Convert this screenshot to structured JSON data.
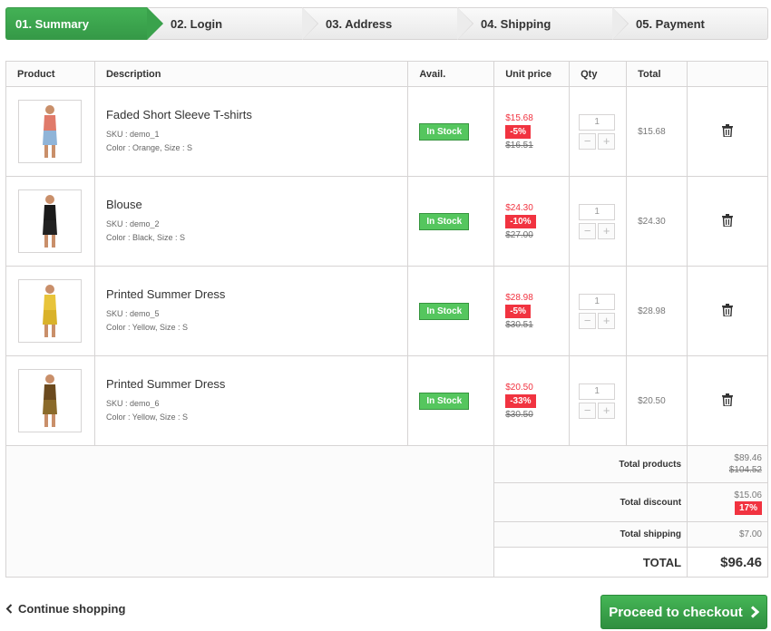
{
  "steps": [
    "01. Summary",
    "02. Login",
    "03. Address",
    "04. Shipping",
    "05. Payment"
  ],
  "table": {
    "headers": {
      "product": "Product",
      "description": "Description",
      "avail": "Avail.",
      "unit_price": "Unit price",
      "qty": "Qty",
      "total": "Total"
    },
    "items": [
      {
        "name": "Faded Short Sleeve T-shirts",
        "sku": "SKU : demo_1",
        "attrs": "Color : Orange, Size : S",
        "avail": "In Stock",
        "price": "$15.68",
        "discount": "-5%",
        "old_price": "$16.51",
        "qty": "1",
        "total": "$15.68",
        "colors": {
          "top": "#e07a6a",
          "bottom": "#8fb4d8"
        }
      },
      {
        "name": "Blouse",
        "sku": "SKU : demo_2",
        "attrs": "Color : Black, Size : S",
        "avail": "In Stock",
        "price": "$24.30",
        "discount": "-10%",
        "old_price": "$27.00",
        "qty": "1",
        "total": "$24.30",
        "colors": {
          "top": "#1a1a1a",
          "bottom": "#222222"
        }
      },
      {
        "name": "Printed Summer Dress",
        "sku": "SKU : demo_5",
        "attrs": "Color : Yellow, Size : S",
        "avail": "In Stock",
        "price": "$28.98",
        "discount": "-5%",
        "old_price": "$30.51",
        "qty": "1",
        "total": "$28.98",
        "colors": {
          "top": "#e8c43a",
          "bottom": "#d9b22a"
        }
      },
      {
        "name": "Printed Summer Dress",
        "sku": "SKU : demo_6",
        "attrs": "Color : Yellow, Size : S",
        "avail": "In Stock",
        "price": "$20.50",
        "discount": "-33%",
        "old_price": "$30.50",
        "qty": "1",
        "total": "$20.50",
        "colors": {
          "top": "#6b4a1e",
          "bottom": "#8a6a2a"
        }
      }
    ],
    "summary": {
      "total_products_label": "Total products",
      "total_products": "$89.46",
      "total_products_old": "$104.52",
      "total_discount_label": "Total discount",
      "total_discount": "$15.06",
      "total_discount_pct": "17%",
      "total_shipping_label": "Total shipping",
      "total_shipping": "$7.00",
      "total_label": "TOTAL",
      "total": "$96.46"
    }
  },
  "continue_label": "Continue shopping",
  "checkout_label": "Proceed to checkout",
  "qty_minus": "−",
  "qty_plus": "+",
  "theme": {
    "accent": "#43b155",
    "discount": "#f13340"
  }
}
